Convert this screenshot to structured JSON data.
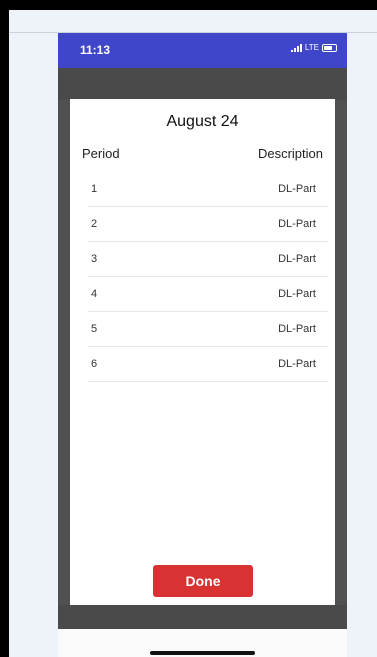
{
  "status_bar": {
    "time": "11:13",
    "network": "LTE"
  },
  "modal": {
    "title": "August 24",
    "columns": {
      "period": "Period",
      "description": "Description"
    },
    "rows": [
      {
        "period": "1",
        "description": "DL-Part"
      },
      {
        "period": "2",
        "description": "DL-Part"
      },
      {
        "period": "3",
        "description": "DL-Part"
      },
      {
        "period": "4",
        "description": "DL-Part"
      },
      {
        "period": "5",
        "description": "DL-Part"
      },
      {
        "period": "6",
        "description": "DL-Part"
      }
    ],
    "done_label": "Done"
  },
  "colors": {
    "status_bar": "#3f46c9",
    "done_button": "#d93232",
    "overlay": "#505050"
  }
}
